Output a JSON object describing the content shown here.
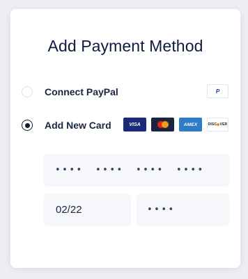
{
  "title": "Add Payment Method",
  "options": [
    {
      "label": "Connect PayPal",
      "selected": false
    },
    {
      "label": "Add New Card",
      "selected": true
    }
  ],
  "brands": {
    "paypal": "P",
    "visa": "VISA",
    "amex": "AMEX",
    "discover": "DISC VER"
  },
  "card": {
    "number_groups": [
      "••••",
      "••••",
      "••••",
      "••••"
    ],
    "expiry": "02/22",
    "cvc": "••••"
  },
  "colors": {
    "title": "#0d1b3e",
    "radio_checked": "#111a35",
    "field_bg": "#f6f7fb",
    "visa": "#1a2a78",
    "amex": "#2e7cc8"
  }
}
